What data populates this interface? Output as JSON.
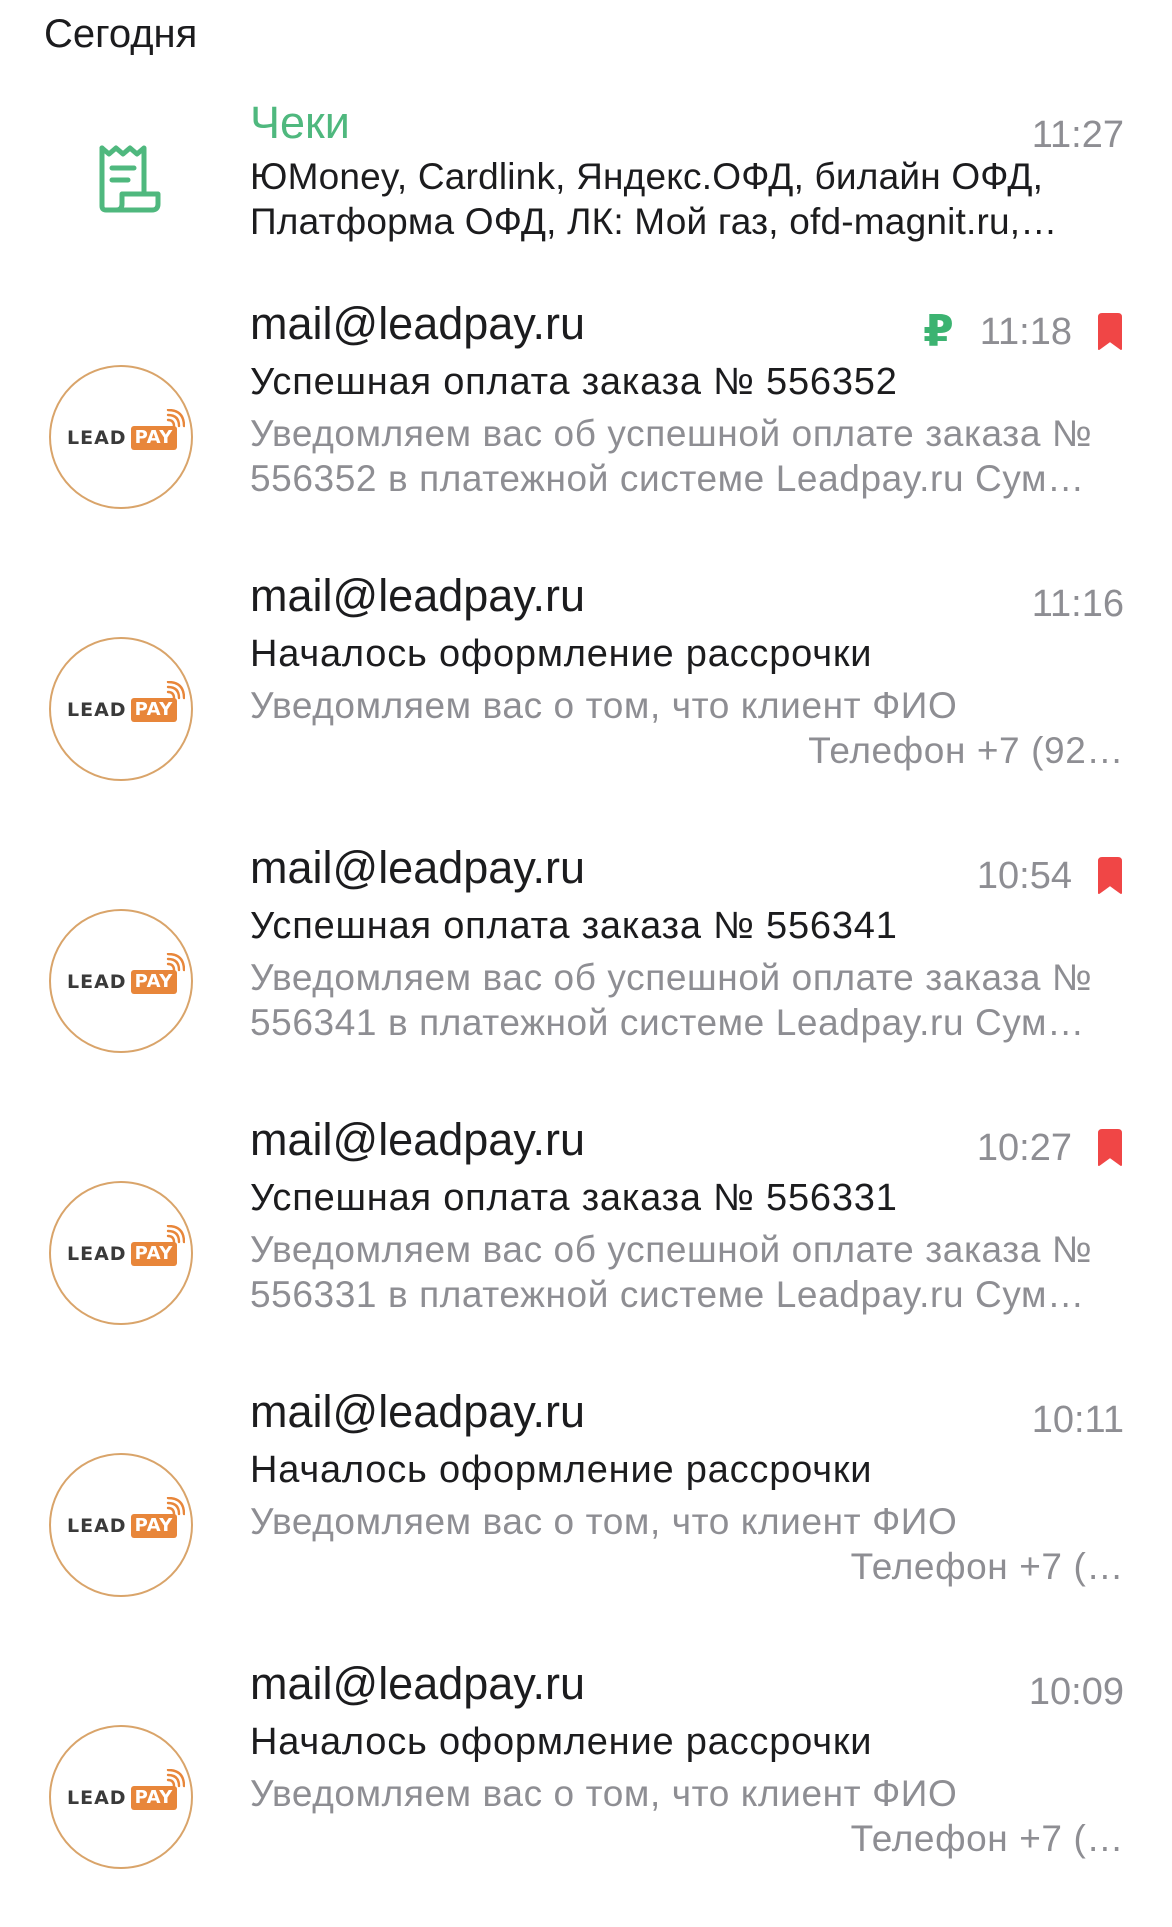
{
  "section": {
    "title": "Сегодня"
  },
  "receipts": {
    "sender": "Чеки",
    "time": "11:27",
    "preview_line1": "ЮMoney, Cardlink, Яндекс.ОФД, билайн ОФД,",
    "preview_line2": "Платформа ОФД, ЛК: Мой газ, ofd-magnit.ru,…",
    "icon": "receipt-icon",
    "color": "#4fb87e"
  },
  "avatar": {
    "lead": "LEAD",
    "pay": "PAY",
    "brand_color": "#e8863a"
  },
  "colors": {
    "bookmark": "#f04646",
    "ruble": "#3cb371",
    "secondary": "#8e8e93"
  },
  "mails": [
    {
      "sender": "mail@leadpay.ru",
      "time": "11:18",
      "ruble": "₽",
      "bookmarked": true,
      "subject": "Успешная оплата заказа № 556352",
      "preview_line1": "Уведомляем вас об успешной оплате заказа №",
      "preview_line2": "556352 в платежной системе Leadpay.ru Сум…",
      "line2_align": "left"
    },
    {
      "sender": "mail@leadpay.ru",
      "time": "11:16",
      "bookmarked": false,
      "subject": "Началось оформление рассрочки",
      "preview_line1": "Уведомляем вас о том, что клиент ФИО",
      "preview_line2": "Телефон +7 (92…",
      "line2_align": "right"
    },
    {
      "sender": "mail@leadpay.ru",
      "time": "10:54",
      "bookmarked": true,
      "subject": "Успешная оплата заказа № 556341",
      "preview_line1": "Уведомляем вас об успешной оплате заказа №",
      "preview_line2": "556341 в платежной системе Leadpay.ru Сум…",
      "line2_align": "left"
    },
    {
      "sender": "mail@leadpay.ru",
      "time": "10:27",
      "bookmarked": true,
      "subject": "Успешная оплата заказа № 556331",
      "preview_line1": "Уведомляем вас об успешной оплате заказа №",
      "preview_line2": "556331 в платежной системе Leadpay.ru Сум…",
      "line2_align": "left"
    },
    {
      "sender": "mail@leadpay.ru",
      "time": "10:11",
      "bookmarked": false,
      "subject": "Началось оформление рассрочки",
      "preview_line1": "Уведомляем вас о том, что клиент ФИО",
      "preview_line2": "Телефон +7 (…",
      "line2_align": "right"
    },
    {
      "sender": "mail@leadpay.ru",
      "time": "10:09",
      "bookmarked": false,
      "subject": "Началось оформление рассрочки",
      "preview_line1": "Уведомляем вас о том, что клиент ФИО",
      "preview_line2": "Телефон +7 (…",
      "line2_align": "right"
    }
  ]
}
